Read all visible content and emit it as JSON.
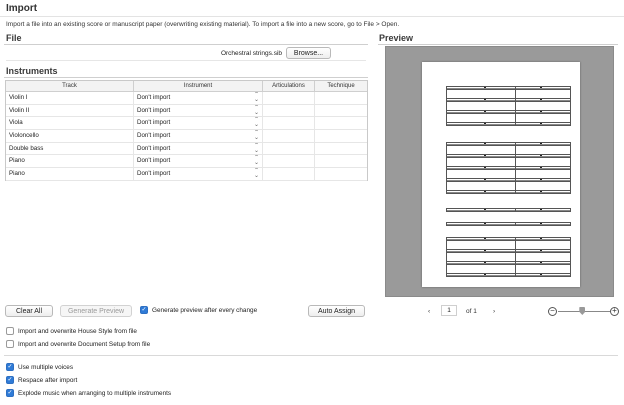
{
  "title": "Import",
  "intro": "Import a file into an existing score or manuscript paper (overwriting existing material). To import a file into a new score, go to File > Open.",
  "file": {
    "heading": "File",
    "filename": "Orchestral strings.sib",
    "browse_label": "Browse..."
  },
  "instruments": {
    "heading": "Instruments",
    "columns": [
      "Track",
      "Instrument",
      "Articulations",
      "Technique"
    ],
    "rows": [
      {
        "track": "Violin I",
        "instrument": "Don't import"
      },
      {
        "track": "Violin II",
        "instrument": "Don't import"
      },
      {
        "track": "Viola",
        "instrument": "Don't import"
      },
      {
        "track": "Violoncello",
        "instrument": "Don't import"
      },
      {
        "track": "Double bass",
        "instrument": "Don't import"
      },
      {
        "track": "Piano",
        "instrument": "Don't import"
      },
      {
        "track": "Piano",
        "instrument": "Don't import"
      }
    ]
  },
  "buttons": {
    "clear_all": "Clear All",
    "generate_preview": "Generate Preview",
    "auto_assign": "Auto Assign"
  },
  "generate_after_change": {
    "label": "Generate preview after every change",
    "checked": true
  },
  "options": [
    {
      "label": "Import and overwrite House Style from file",
      "checked": false
    },
    {
      "label": "Import and overwrite Document Setup from file",
      "checked": false
    }
  ],
  "options2": [
    {
      "label": "Use multiple voices",
      "checked": true
    },
    {
      "label": "Respace after import",
      "checked": true
    },
    {
      "label": "Explode music when arranging to multiple instruments",
      "checked": true
    }
  ],
  "preview": {
    "heading": "Preview",
    "page_value": "1",
    "of_label": "of 1",
    "prev_icon": "chevron-left-icon",
    "next_icon": "chevron-right-icon",
    "zoom_level": 0.45
  },
  "colors": {
    "accent": "#2f7bd7",
    "preview_bg": "#9a9a9a"
  }
}
